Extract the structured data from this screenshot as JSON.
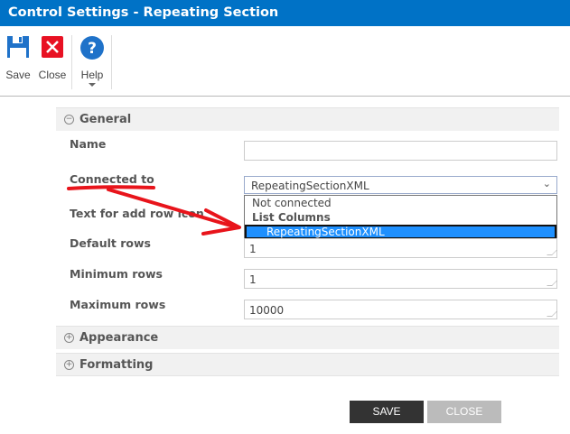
{
  "title": "Control Settings - Repeating Section",
  "ribbon": {
    "save": "Save",
    "close": "Close",
    "help": "Help"
  },
  "sections": {
    "general": "General",
    "appearance": "Appearance",
    "formatting": "Formatting"
  },
  "fields": {
    "name": {
      "label": "Name",
      "value": ""
    },
    "connected_to": {
      "label": "Connected to",
      "value": "RepeatingSectionXML",
      "options": [
        "Not connected",
        "List Columns",
        "RepeatingSectionXML"
      ],
      "selected": "RepeatingSectionXML"
    },
    "add_row_text": {
      "label": "Text for add row icon"
    },
    "default_rows": {
      "label": "Default rows",
      "value": "1"
    },
    "minimum_rows": {
      "label": "Minimum rows",
      "value": "1"
    },
    "maximum_rows": {
      "label": "Maximum rows",
      "value": "10000"
    }
  },
  "footer": {
    "save": "SAVE",
    "close": "CLOSE"
  },
  "colors": {
    "accent": "#0072c6",
    "annotation": "#e8141b",
    "selection": "#1e90ff"
  }
}
